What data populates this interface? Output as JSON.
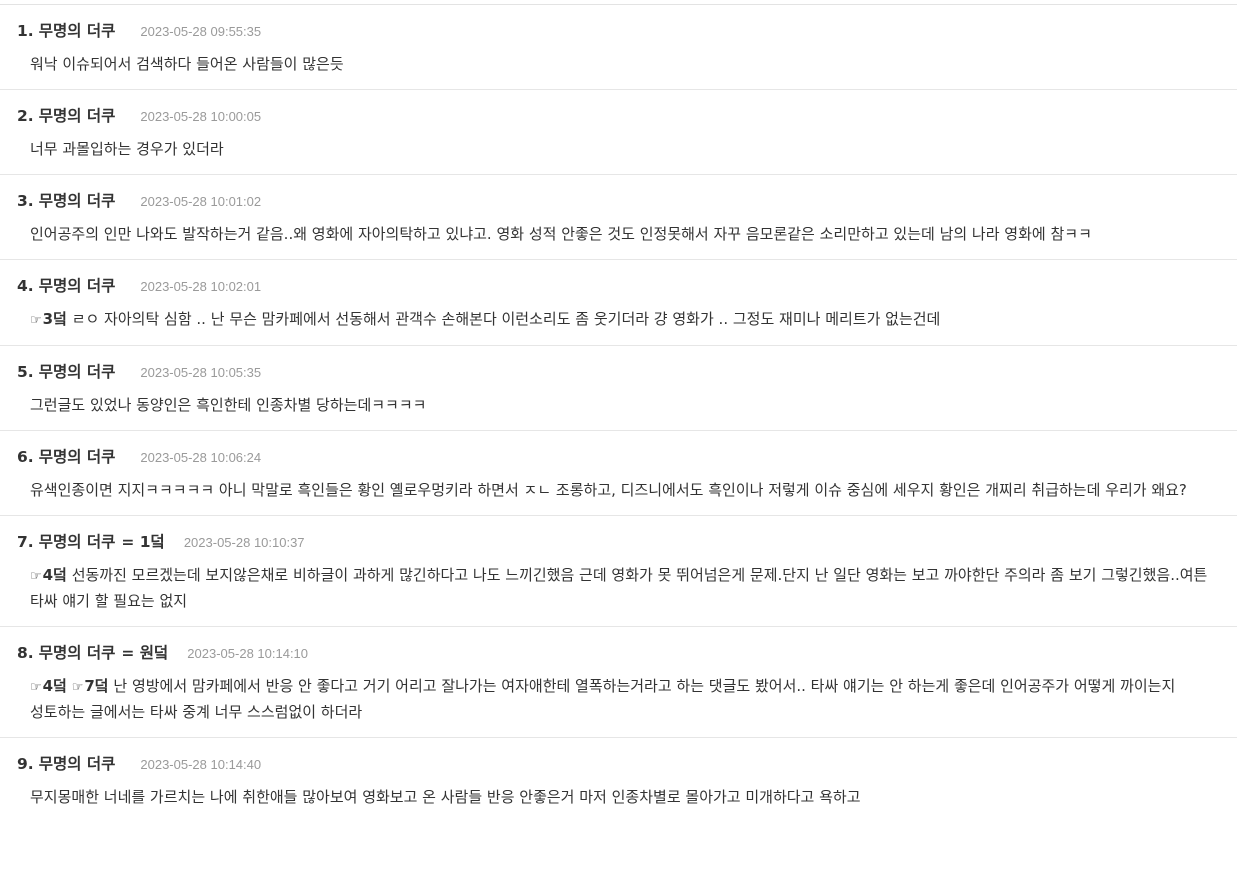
{
  "comments": [
    {
      "num": "1.",
      "nick": "무명의 더쿠",
      "suffix": "",
      "time": "2023-05-28 09:55:35",
      "refs": [],
      "text": "워낙 이슈되어서 검색하다 들어온 사람들이 많은듯"
    },
    {
      "num": "2.",
      "nick": "무명의 더쿠",
      "suffix": "",
      "time": "2023-05-28 10:00:05",
      "refs": [],
      "text": "너무 과몰입하는 경우가 있더라"
    },
    {
      "num": "3.",
      "nick": "무명의 더쿠",
      "suffix": "",
      "time": "2023-05-28 10:01:02",
      "refs": [],
      "text": "인어공주의 인만 나와도 발작하는거 같음..왜 영화에 자아의탁하고 있냐고. 영화 성적 안좋은 것도 인정못해서 자꾸 음모론같은 소리만하고 있는데 남의 나라 영화에 참ㅋㅋ"
    },
    {
      "num": "4.",
      "nick": "무명의 더쿠",
      "suffix": "",
      "time": "2023-05-28 10:02:01",
      "refs": [
        "3덬"
      ],
      "text": "ㄹㅇ 자아의탁 심함 .. 난 무슨 맘카페에서 선동해서 관객수 손해본다 이런소리도 좀 웃기더라 걍 영화가 .. 그정도 재미나 메리트가 없는건데"
    },
    {
      "num": "5.",
      "nick": "무명의 더쿠",
      "suffix": "",
      "time": "2023-05-28 10:05:35",
      "refs": [],
      "text": "그런글도 있었나 동양인은 흑인한테 인종차별 당하는데ㅋㅋㅋㅋ"
    },
    {
      "num": "6.",
      "nick": "무명의 더쿠",
      "suffix": "",
      "time": "2023-05-28 10:06:24",
      "refs": [],
      "text": "유색인종이면 지지ㅋㅋㅋㅋㅋ 아니 막말로 흑인들은 황인 옐로우멍키라 하면서 ㅈㄴ 조롱하고, 디즈니에서도 흑인이나 저렇게 이슈 중심에 세우지 황인은 개찌리 취급하는데 우리가 왜요?"
    },
    {
      "num": "7.",
      "nick": "무명의 더쿠",
      "suffix": "= 1덬",
      "time": "2023-05-28 10:10:37",
      "refs": [
        "4덬"
      ],
      "text": "선동까진 모르겠는데 보지않은채로 비하글이 과하게 많긴하다고 나도 느끼긴했음 근데 영화가 못 뛰어넘은게 문제.단지 난 일단 영화는 보고 까야한단 주의라 좀 보기 그렇긴했음..여튼 타싸 얘기 할 필요는 없지"
    },
    {
      "num": "8.",
      "nick": "무명의 더쿠",
      "suffix": "= 원덬",
      "time": "2023-05-28 10:14:10",
      "refs": [
        "4덬",
        "7덬"
      ],
      "text": "난 영방에서 맘카페에서 반응 안 좋다고 거기 어리고 잘나가는 여자애한테 열폭하는거라고 하는 댓글도 봤어서.. 타싸 얘기는 안 하는게 좋은데 인어공주가 어떻게 까이는지 성토하는 글에서는 타싸 중계 너무 스스럼없이 하더라"
    },
    {
      "num": "9.",
      "nick": "무명의 더쿠",
      "suffix": "",
      "time": "2023-05-28 10:14:40",
      "refs": [],
      "text": "무지몽매한 너네를 가르치는 나에 취한애들 많아보여 영화보고 온 사람들 반응 안좋은거 마저 인종차별로 몰아가고 미개하다고 욕하고"
    }
  ],
  "icons": {
    "reply_ref": "pointing-hand-icon"
  }
}
